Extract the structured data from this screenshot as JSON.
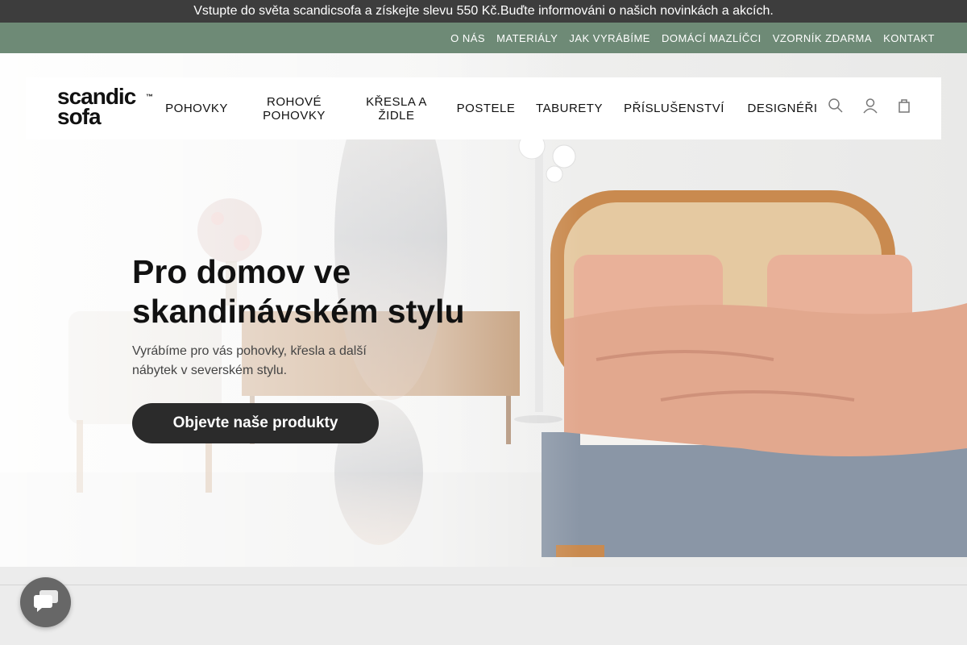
{
  "promo": {
    "text": "Vstupte do světa scandicsofa a získejte slevu 550 Kč.Buďte informováni o našich novinkách a akcích."
  },
  "secondary_nav": {
    "items": [
      "O NÁS",
      "MATERIÁLY",
      "JAK VYRÁBÍME",
      "DOMÁCÍ MAZLÍČCI",
      "VZORNÍK ZDARMA",
      "KONTAKT"
    ]
  },
  "logo": {
    "line1": "scandic",
    "line2": "sofa",
    "tm": "™"
  },
  "main_nav": {
    "items": [
      {
        "line1": "POHOVKY",
        "line2": ""
      },
      {
        "line1": "ROHOVÉ",
        "line2": "POHOVKY"
      },
      {
        "line1": "KŘESLA A",
        "line2": "ŽIDLE"
      },
      {
        "line1": "POSTELE",
        "line2": ""
      },
      {
        "line1": "TABURETY",
        "line2": ""
      },
      {
        "line1": "PŘÍSLUŠENSTVÍ",
        "line2": ""
      },
      {
        "line1": "DESIGNÉŘI",
        "line2": ""
      }
    ]
  },
  "header_icons": [
    "search-icon",
    "account-icon",
    "cart-icon"
  ],
  "hero": {
    "title_line1": "Pro domov ve",
    "title_line2": "skandinávském stylu",
    "subtitle_line1": "Vyrábíme pro vás pohovky, křesla a další",
    "subtitle_line2": "nábytek v severském stylu.",
    "cta": "Objevte naše produkty"
  },
  "chat": {
    "icon": "chat-icon"
  },
  "colors": {
    "promo_bg": "#3d3d3d",
    "secondary_nav_bg": "#6e8a76",
    "cta_bg": "#2b2b2b",
    "bedding": "#e2a88e",
    "bed_base": "#8a96a6"
  }
}
